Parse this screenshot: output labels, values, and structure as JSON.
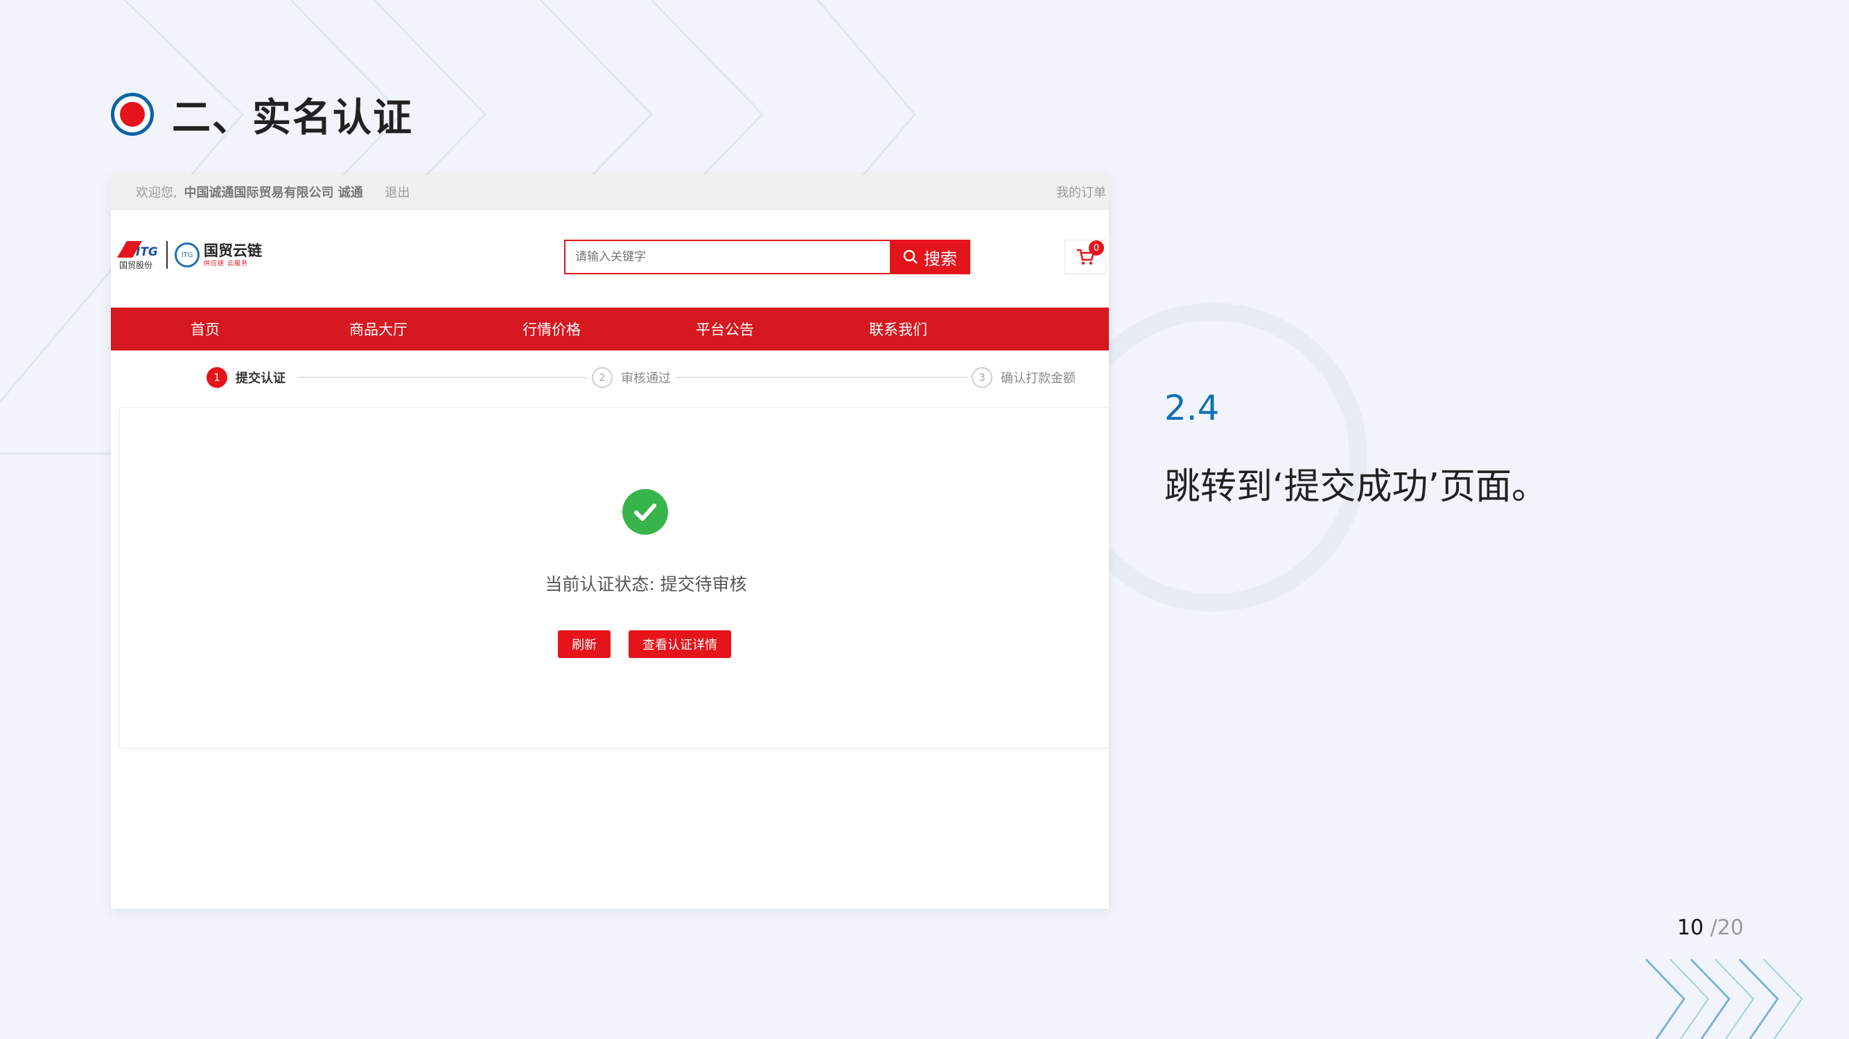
{
  "slide": {
    "title": "二、实名认证",
    "step_number": "2.4",
    "step_description": "跳转到‘提交成功’页面。",
    "page_current": "10",
    "page_total": "/20"
  },
  "colors": {
    "brand_red": "#e5141b",
    "nav_red": "#d61820",
    "title_blue": "#0b63a8",
    "success_green": "#38b54a",
    "step_blue": "#1170b6"
  },
  "site": {
    "topbar": {
      "welcome": "欢迎您,",
      "company": "中国诚通国际贸易有限公司 诚通",
      "logout": "退出",
      "my_orders": "我的订单"
    },
    "logo": {
      "itg_text": "ITG",
      "itg_sub": "国贸股份",
      "yun_name": "国贸云链",
      "yun_slogan": "供应链 云服务"
    },
    "search": {
      "placeholder": "请输入关键字",
      "button": "搜索",
      "icon": "search-icon"
    },
    "cart": {
      "count": "0",
      "icon": "cart-icon"
    },
    "nav": [
      "首页",
      "商品大厅",
      "行情价格",
      "平台公告",
      "联系我们"
    ],
    "steps": [
      {
        "num": "1",
        "label": "提交认证",
        "state": "active"
      },
      {
        "num": "2",
        "label": "审核通过",
        "state": "todo"
      },
      {
        "num": "3",
        "label": "确认打款金额",
        "state": "todo"
      }
    ],
    "result": {
      "icon": "check-circle-icon",
      "status_text": "当前认证状态: 提交待审核",
      "refresh": "刷新",
      "view_detail": "查看认证详情"
    }
  }
}
